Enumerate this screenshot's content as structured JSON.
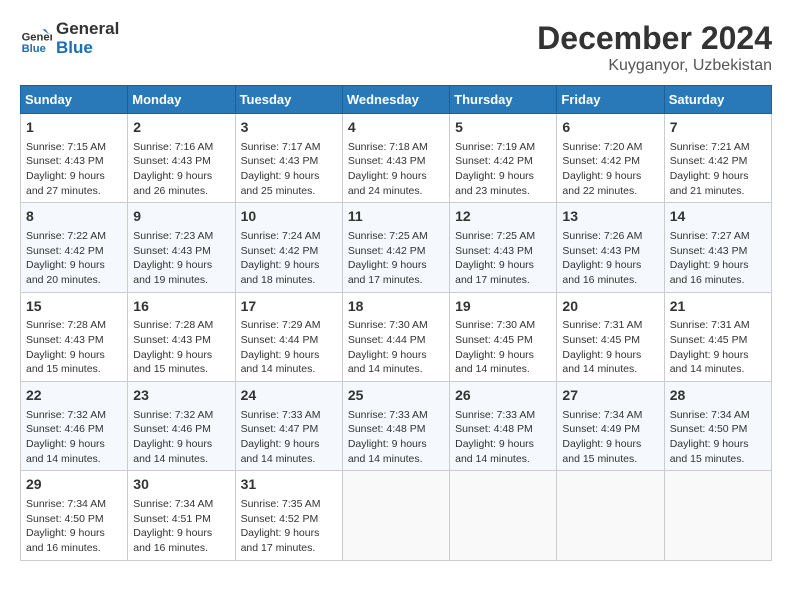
{
  "header": {
    "logo_line1": "General",
    "logo_line2": "Blue",
    "month_year": "December 2024",
    "location": "Kuyganyor, Uzbekistan"
  },
  "weekdays": [
    "Sunday",
    "Monday",
    "Tuesday",
    "Wednesday",
    "Thursday",
    "Friday",
    "Saturday"
  ],
  "weeks": [
    [
      {
        "day": "1",
        "info": "Sunrise: 7:15 AM\nSunset: 4:43 PM\nDaylight: 9 hours\nand 27 minutes."
      },
      {
        "day": "2",
        "info": "Sunrise: 7:16 AM\nSunset: 4:43 PM\nDaylight: 9 hours\nand 26 minutes."
      },
      {
        "day": "3",
        "info": "Sunrise: 7:17 AM\nSunset: 4:43 PM\nDaylight: 9 hours\nand 25 minutes."
      },
      {
        "day": "4",
        "info": "Sunrise: 7:18 AM\nSunset: 4:43 PM\nDaylight: 9 hours\nand 24 minutes."
      },
      {
        "day": "5",
        "info": "Sunrise: 7:19 AM\nSunset: 4:42 PM\nDaylight: 9 hours\nand 23 minutes."
      },
      {
        "day": "6",
        "info": "Sunrise: 7:20 AM\nSunset: 4:42 PM\nDaylight: 9 hours\nand 22 minutes."
      },
      {
        "day": "7",
        "info": "Sunrise: 7:21 AM\nSunset: 4:42 PM\nDaylight: 9 hours\nand 21 minutes."
      }
    ],
    [
      {
        "day": "8",
        "info": "Sunrise: 7:22 AM\nSunset: 4:42 PM\nDaylight: 9 hours\nand 20 minutes."
      },
      {
        "day": "9",
        "info": "Sunrise: 7:23 AM\nSunset: 4:43 PM\nDaylight: 9 hours\nand 19 minutes."
      },
      {
        "day": "10",
        "info": "Sunrise: 7:24 AM\nSunset: 4:42 PM\nDaylight: 9 hours\nand 18 minutes."
      },
      {
        "day": "11",
        "info": "Sunrise: 7:25 AM\nSunset: 4:42 PM\nDaylight: 9 hours\nand 17 minutes."
      },
      {
        "day": "12",
        "info": "Sunrise: 7:25 AM\nSunset: 4:43 PM\nDaylight: 9 hours\nand 17 minutes."
      },
      {
        "day": "13",
        "info": "Sunrise: 7:26 AM\nSunset: 4:43 PM\nDaylight: 9 hours\nand 16 minutes."
      },
      {
        "day": "14",
        "info": "Sunrise: 7:27 AM\nSunset: 4:43 PM\nDaylight: 9 hours\nand 16 minutes."
      }
    ],
    [
      {
        "day": "15",
        "info": "Sunrise: 7:28 AM\nSunset: 4:43 PM\nDaylight: 9 hours\nand 15 minutes."
      },
      {
        "day": "16",
        "info": "Sunrise: 7:28 AM\nSunset: 4:43 PM\nDaylight: 9 hours\nand 15 minutes."
      },
      {
        "day": "17",
        "info": "Sunrise: 7:29 AM\nSunset: 4:44 PM\nDaylight: 9 hours\nand 14 minutes."
      },
      {
        "day": "18",
        "info": "Sunrise: 7:30 AM\nSunset: 4:44 PM\nDaylight: 9 hours\nand 14 minutes."
      },
      {
        "day": "19",
        "info": "Sunrise: 7:30 AM\nSunset: 4:45 PM\nDaylight: 9 hours\nand 14 minutes."
      },
      {
        "day": "20",
        "info": "Sunrise: 7:31 AM\nSunset: 4:45 PM\nDaylight: 9 hours\nand 14 minutes."
      },
      {
        "day": "21",
        "info": "Sunrise: 7:31 AM\nSunset: 4:45 PM\nDaylight: 9 hours\nand 14 minutes."
      }
    ],
    [
      {
        "day": "22",
        "info": "Sunrise: 7:32 AM\nSunset: 4:46 PM\nDaylight: 9 hours\nand 14 minutes."
      },
      {
        "day": "23",
        "info": "Sunrise: 7:32 AM\nSunset: 4:46 PM\nDaylight: 9 hours\nand 14 minutes."
      },
      {
        "day": "24",
        "info": "Sunrise: 7:33 AM\nSunset: 4:47 PM\nDaylight: 9 hours\nand 14 minutes."
      },
      {
        "day": "25",
        "info": "Sunrise: 7:33 AM\nSunset: 4:48 PM\nDaylight: 9 hours\nand 14 minutes."
      },
      {
        "day": "26",
        "info": "Sunrise: 7:33 AM\nSunset: 4:48 PM\nDaylight: 9 hours\nand 14 minutes."
      },
      {
        "day": "27",
        "info": "Sunrise: 7:34 AM\nSunset: 4:49 PM\nDaylight: 9 hours\nand 15 minutes."
      },
      {
        "day": "28",
        "info": "Sunrise: 7:34 AM\nSunset: 4:50 PM\nDaylight: 9 hours\nand 15 minutes."
      }
    ],
    [
      {
        "day": "29",
        "info": "Sunrise: 7:34 AM\nSunset: 4:50 PM\nDaylight: 9 hours\nand 16 minutes."
      },
      {
        "day": "30",
        "info": "Sunrise: 7:34 AM\nSunset: 4:51 PM\nDaylight: 9 hours\nand 16 minutes."
      },
      {
        "day": "31",
        "info": "Sunrise: 7:35 AM\nSunset: 4:52 PM\nDaylight: 9 hours\nand 17 minutes."
      },
      null,
      null,
      null,
      null
    ]
  ]
}
